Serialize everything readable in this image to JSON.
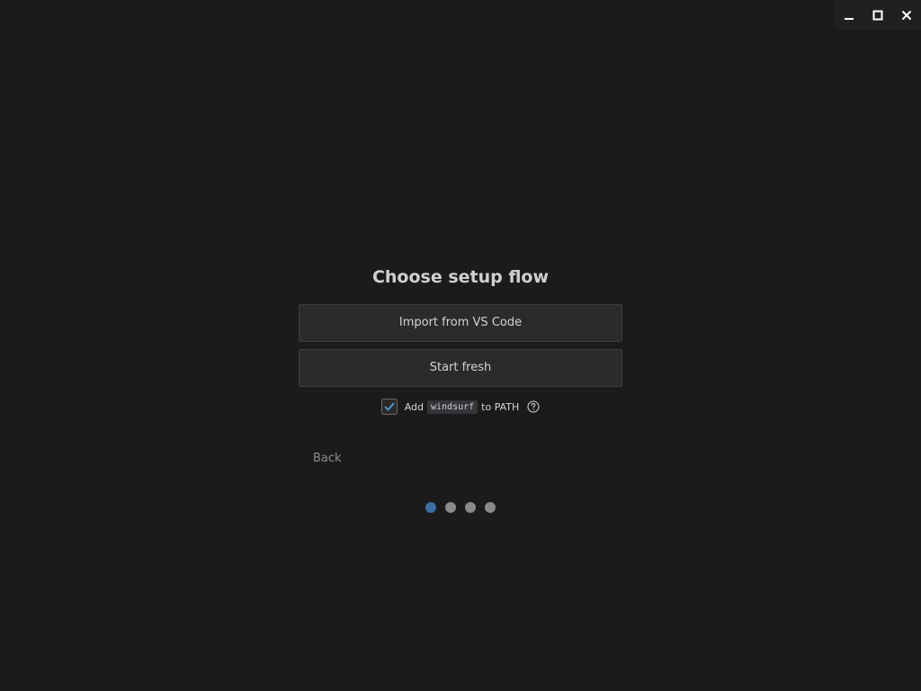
{
  "window": {
    "controls": [
      "minimize",
      "maximize",
      "close"
    ]
  },
  "setup": {
    "title": "Choose setup flow",
    "import_label": "Import from VS Code",
    "fresh_label": "Start fresh",
    "path_prefix": "Add",
    "path_command": "windsurf",
    "path_suffix": "to PATH",
    "path_checked": true,
    "back_label": "Back"
  },
  "progress": {
    "total_steps": 4,
    "current_step": 1
  },
  "colors": {
    "accent": "#3a6ea5",
    "check": "#4a9eda",
    "background": "#1b1b1b"
  },
  "icons": {
    "minimize": "minimize-icon",
    "maximize": "maximize-icon",
    "close": "close-icon",
    "check": "check-icon",
    "help": "help-circle-icon"
  }
}
